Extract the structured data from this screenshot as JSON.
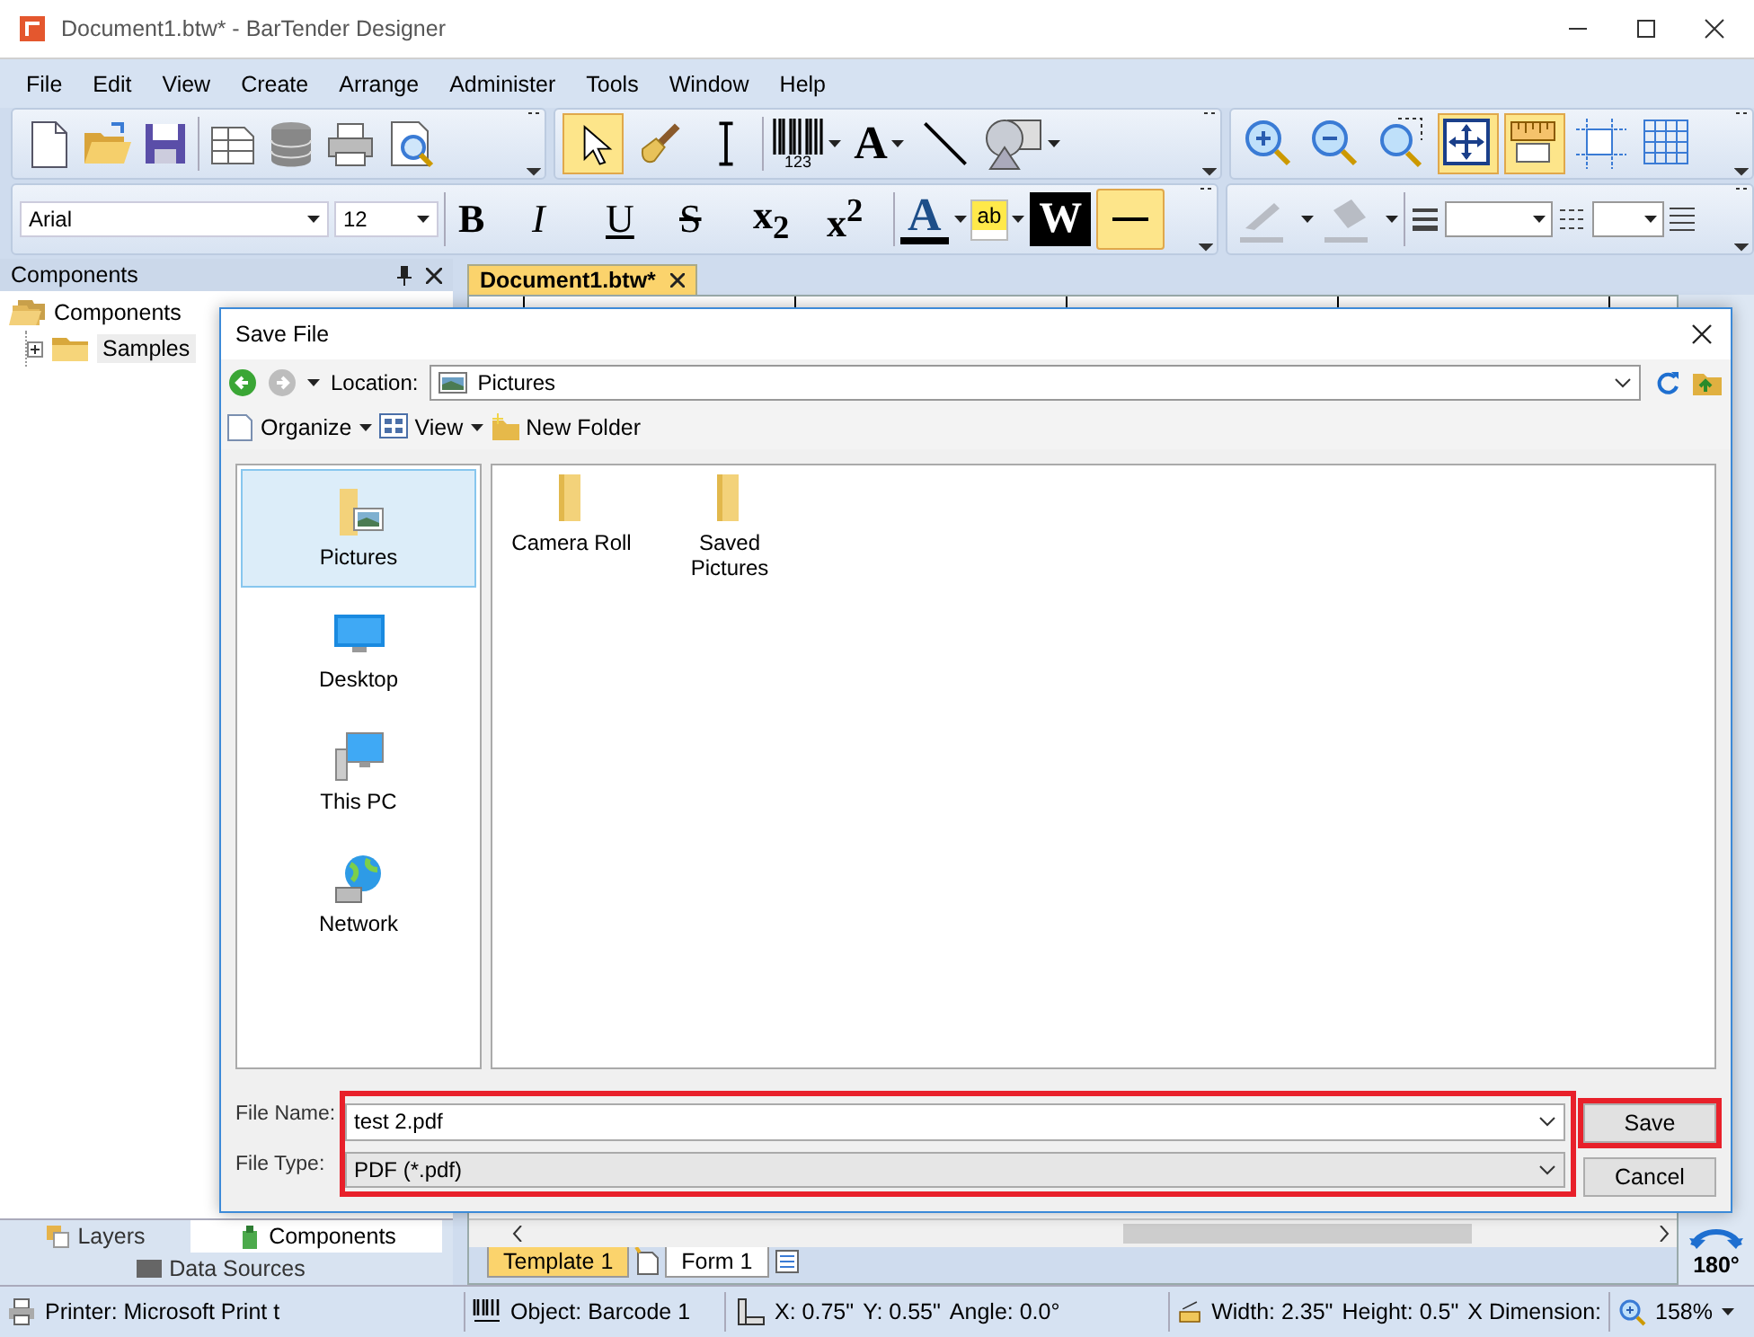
{
  "window": {
    "title": "Document1.btw* - BarTender Designer"
  },
  "menu": [
    "File",
    "Edit",
    "View",
    "Create",
    "Arrange",
    "Administer",
    "Tools",
    "Window",
    "Help"
  ],
  "standard_toolbar": {
    "buttons": [
      {
        "selected": false
      },
      {
        "selected": false
      },
      {
        "selected": false
      },
      {
        "selected": false
      },
      {
        "selected": false
      },
      {
        "selected": false
      },
      {
        "selected": false
      }
    ]
  },
  "object_toolbar": {
    "buttons": [
      {
        "selected": true
      },
      {
        "selected": false
      },
      {
        "selected": false
      },
      {
        "selected": false
      },
      {
        "selected": false
      },
      {
        "selected": false
      },
      {
        "selected": false
      }
    ],
    "barcode_caption": "123",
    "text_label": "A"
  },
  "view_toolbar": {
    "buttons": [
      {
        "selected": false
      },
      {
        "selected": false
      },
      {
        "selected": false
      },
      {
        "selected": true
      },
      {
        "selected": true
      },
      {
        "selected": false
      },
      {
        "selected": false
      }
    ]
  },
  "format_toolbar": {
    "font": "Arial",
    "size": "12",
    "styles": [
      {
        "label": "B"
      },
      {
        "label": "I"
      },
      {
        "label": "U"
      },
      {
        "label": "S"
      },
      {
        "label": "x$_{2}$"
      },
      {
        "label": "x$^{2}$"
      }
    ],
    "font_color_label": "A",
    "highlight_label": "ab",
    "reverse_label": "W",
    "line_button_selected": true,
    "fill_disabled": true
  },
  "left_panel": {
    "title": "Components",
    "tree": [
      {
        "label": "Components",
        "expanded": true,
        "selected": false,
        "children": [
          {
            "label": "Samples",
            "expanded": false,
            "selected": true
          }
        ]
      }
    ],
    "tabs": [
      {
        "label": "Layers",
        "selected": false
      },
      {
        "label": "Components",
        "selected": true
      },
      {
        "label": "Data Sources",
        "selected": false
      }
    ]
  },
  "document": {
    "tab": "Document1.btw*",
    "page_tabs": [
      {
        "label": "Template 1",
        "selected": true
      },
      {
        "label": "Form 1",
        "selected": false
      }
    ],
    "rotation": "180°"
  },
  "dialog": {
    "title": "Save File",
    "location_label": "Location:",
    "location": "Pictures",
    "toolbar": [
      "Organize",
      "View",
      "New Folder"
    ],
    "places": [
      {
        "label": "Pictures",
        "selected": true
      },
      {
        "label": "Desktop",
        "selected": false
      },
      {
        "label": "This PC",
        "selected": false
      },
      {
        "label": "Network",
        "selected": false
      }
    ],
    "files": [
      "Camera Roll",
      "Saved Pictures"
    ],
    "file_name_label": "File Name:",
    "file_name": "test 2.pdf",
    "file_type_label": "File Type:",
    "file_type": "PDF (*.pdf)",
    "fields_highlighted": true,
    "buttons": [
      {
        "label": "Save",
        "highlighted": true
      },
      {
        "label": "Cancel",
        "highlighted": false
      }
    ]
  },
  "status_bar": {
    "printer": "Printer: Microsoft Print t",
    "object": "Object: Barcode 1",
    "x": "X: 0.75\"",
    "y": "Y: 0.55\"",
    "angle": "Angle: 0.0°",
    "width": "Width: 2.35\"",
    "height": "Height: 0.5\"",
    "x_dimension": "X Dimension:",
    "zoom": "158%"
  }
}
